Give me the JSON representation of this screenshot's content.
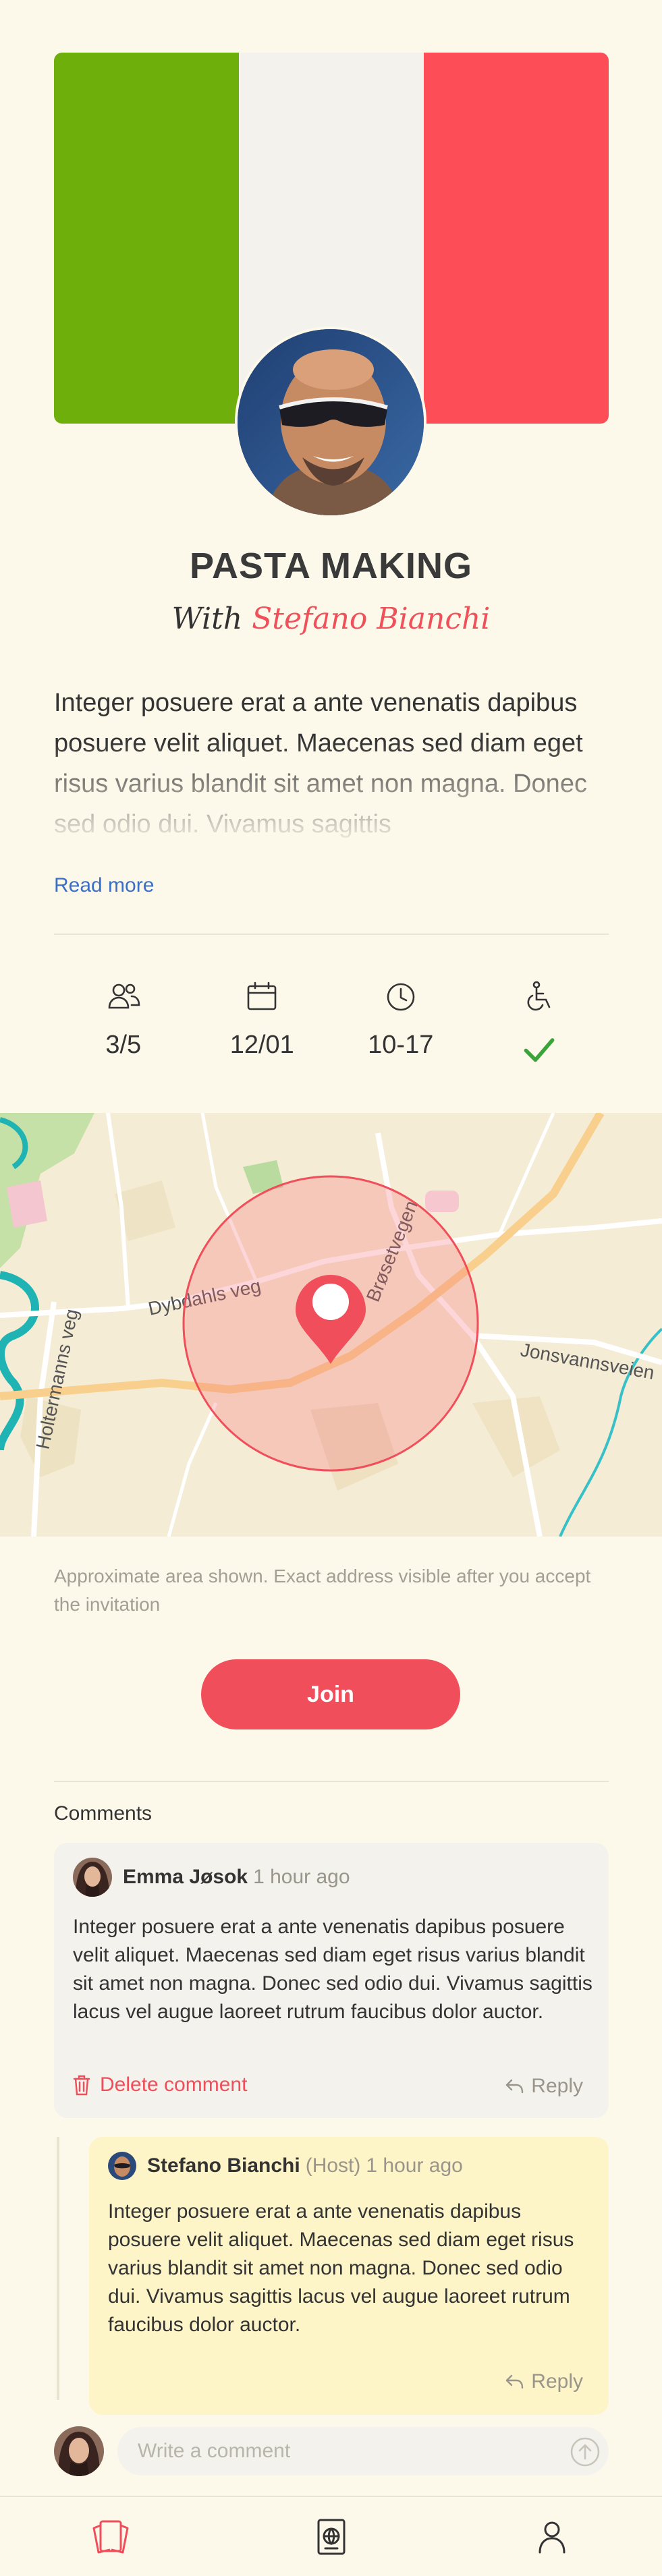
{
  "colors": {
    "flag_green": "#6faf0b",
    "flag_white": "#f3f2ed",
    "flag_red": "#fd4d57",
    "accent_red": "#f04e5a",
    "link_blue": "#3b6fc7",
    "check_green": "#3aa43a",
    "host_comment_bg": "#fdf4c8",
    "comment_bg": "#f3f2ed"
  },
  "event": {
    "title": "PASTA MAKING",
    "with_label": "With",
    "host_name": "Stefano Bianchi",
    "description": "Integer posuere erat a ante venenatis dapibus posuere velit aliquet. Maecenas sed diam eget risus varius blandit sit amet non magna. Donec sed odio dui. Vivamus sagittis",
    "read_more": "Read more"
  },
  "stats": [
    {
      "icon": "people-icon",
      "value": "3/5"
    },
    {
      "icon": "calendar-icon",
      "value": "12/01"
    },
    {
      "icon": "clock-icon",
      "value": "10-17"
    },
    {
      "icon": "wheelchair-icon",
      "value": "",
      "status": "check"
    }
  ],
  "map": {
    "streets": [
      "Dybdahls veg",
      "Brøsetvegen",
      "Holtermanns veg",
      "Jonsvannsveien"
    ],
    "note": "Approximate area shown. Exact address visible after you accept the invitation"
  },
  "join_label": "Join",
  "comments_label": "Comments",
  "comments": [
    {
      "author": "Emma Jøsok",
      "time": "1 hour ago",
      "text": "Integer posuere erat a ante venenatis dapibus posuere velit aliquet. Maecenas sed diam eget risus varius blandit sit amet non magna. Donec sed odio dui. Vivamus sagittis lacus vel augue laoreet rutrum faucibus dolor auctor.",
      "delete_label": "Delete comment",
      "reply_label": "Reply"
    },
    {
      "author": "Stefano Bianchi",
      "host_tag": "(Host)",
      "time": "1 hour ago",
      "text": "Integer posuere erat a ante venenatis dapibus posuere velit aliquet. Maecenas sed diam eget risus varius blandit sit amet non magna. Donec sed odio dui. Vivamus sagittis lacus vel augue laoreet rutrum faucibus dolor auctor.",
      "reply_label": "Reply"
    }
  ],
  "write_comment": {
    "placeholder": "Write a comment"
  },
  "tabs": [
    {
      "icon": "cards-icon",
      "active": true
    },
    {
      "icon": "passport-icon",
      "active": false
    },
    {
      "icon": "profile-icon",
      "active": false
    }
  ]
}
